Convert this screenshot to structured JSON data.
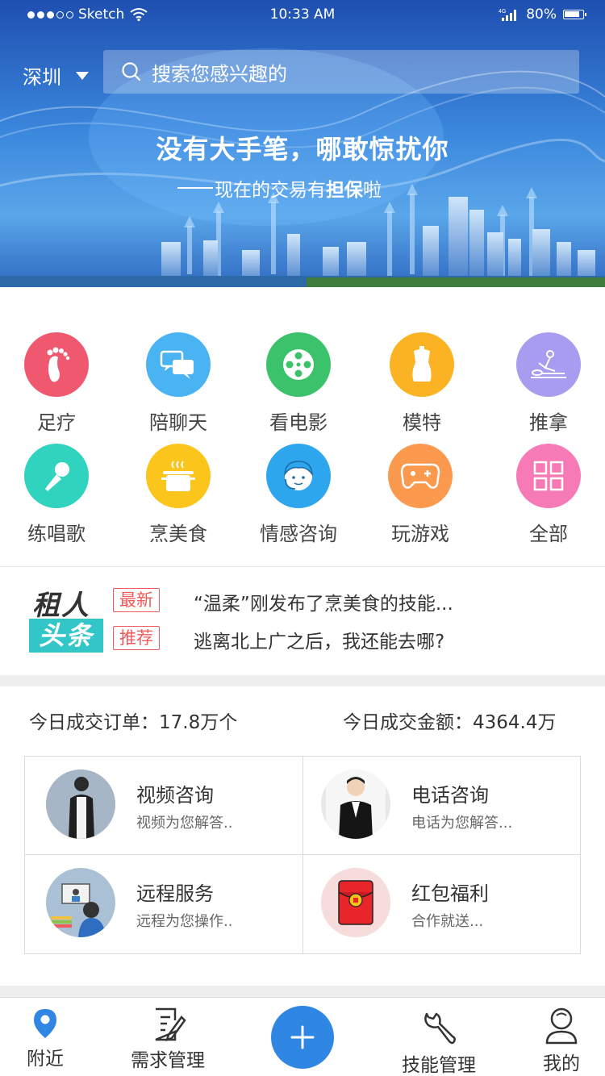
{
  "status": {
    "carrier": "Sketch",
    "time": "10:33 AM",
    "network": "4G",
    "battery": "80%"
  },
  "header": {
    "city": "深圳",
    "search_placeholder": "搜索您感兴趣的"
  },
  "banner": {
    "title": "没有大手笔，哪敢惊扰你",
    "subtitle_pre": "现在的交易有",
    "subtitle_bold": "担保",
    "subtitle_post": "啦"
  },
  "categories": [
    {
      "label": "足疗",
      "icon": "footprint-icon",
      "color": "#f0586f"
    },
    {
      "label": "陪聊天",
      "icon": "chat-bubbles-icon",
      "color": "#4ab3f2"
    },
    {
      "label": "看电影",
      "icon": "film-reel-icon",
      "color": "#3cc26a"
    },
    {
      "label": "模特",
      "icon": "mannequin-icon",
      "color": "#fbb324"
    },
    {
      "label": "推拿",
      "icon": "massage-icon",
      "color": "#a79cf0"
    },
    {
      "label": "练唱歌",
      "icon": "microphone-icon",
      "color": "#2fd3be"
    },
    {
      "label": "烹美食",
      "icon": "cooking-pot-icon",
      "color": "#fbc51c"
    },
    {
      "label": "情感咨询",
      "icon": "counselor-icon",
      "color": "#2ea6ee"
    },
    {
      "label": "玩游戏",
      "icon": "gamepad-icon",
      "color": "#fb9a4f"
    },
    {
      "label": "全部",
      "icon": "grid-icon",
      "color": "#f57ab5"
    }
  ],
  "headlines": {
    "brand_top": "租人",
    "brand_bottom": "头条",
    "items": [
      {
        "tag": "最新",
        "text": "“温柔”刚发布了烹美食的技能..."
      },
      {
        "tag": "推荐",
        "text": "逃离北上广之后，我还能去哪?"
      }
    ]
  },
  "stats": {
    "orders": "今日成交订单：17.8万个",
    "amount": "今日成交金额：4364.4万"
  },
  "services": [
    {
      "title": "视频咨询",
      "desc": "视频为您解答..",
      "icon": "woman-portrait"
    },
    {
      "title": "电话咨询",
      "desc": "电话为您解答...",
      "icon": "man-portrait"
    },
    {
      "title": "远程服务",
      "desc": "远程为您操作..",
      "icon": "remote-desk-icon"
    },
    {
      "title": "红包福利",
      "desc": "合作就送...",
      "icon": "red-envelope-icon"
    }
  ],
  "tabs": [
    {
      "label": "附近",
      "icon": "location-pin-icon",
      "color": "#2f86e3"
    },
    {
      "label": "需求管理",
      "icon": "edit-document-icon"
    },
    {
      "label": "",
      "icon": "plus-icon"
    },
    {
      "label": "技能管理",
      "icon": "wrench-icon"
    },
    {
      "label": "我的",
      "icon": "user-icon"
    }
  ]
}
